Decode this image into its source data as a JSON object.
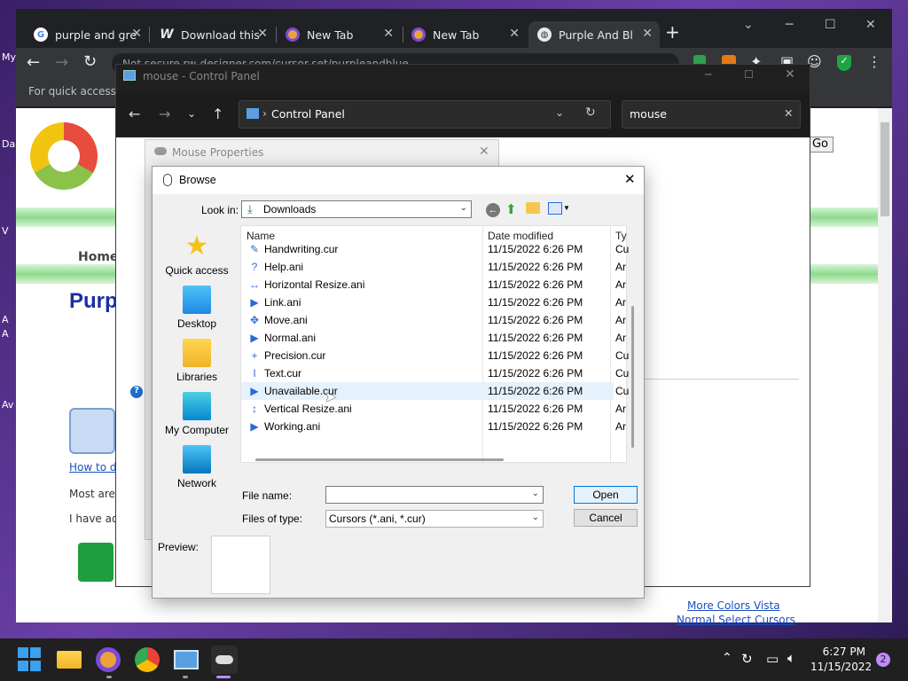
{
  "desktop": {
    "labels": [
      "My",
      "Da",
      "V",
      "A",
      "A",
      "Av"
    ]
  },
  "chrome": {
    "tabs": [
      {
        "label": "purple and gre"
      },
      {
        "label": "Download this"
      },
      {
        "label": "New Tab"
      },
      {
        "label": "New Tab"
      },
      {
        "label": "Purple And Bl"
      }
    ],
    "address": "Not secure   rw-designer.com/cursor-set/purpleandblue",
    "bookmarks_text": "For quick access, p"
  },
  "page": {
    "home": "Home",
    "title": "Purp",
    "go": "Go",
    "how_to": "How to do",
    "most_are": "Most are a",
    "i_have": "I have ad",
    "more_colors": "More Colors Vista",
    "normal_select": "Normal Select Cursors"
  },
  "control_panel": {
    "title": "mouse - Control Panel",
    "address": "Control Panel",
    "search": "mouse"
  },
  "mouse_properties": {
    "title": "Mouse Properties"
  },
  "browse": {
    "title": "Browse",
    "look_in_label": "Look in:",
    "look_in_value": "Downloads",
    "places": [
      {
        "label": "Quick access"
      },
      {
        "label": "Desktop"
      },
      {
        "label": "Libraries"
      },
      {
        "label": "My Computer"
      },
      {
        "label": "Network"
      }
    ],
    "columns": {
      "name": "Name",
      "date": "Date modified",
      "type": "Ty"
    },
    "files": [
      {
        "name": "Handwriting.cur",
        "date": "11/15/2022 6:26 PM",
        "type": "Cu",
        "icon": "✎"
      },
      {
        "name": "Help.ani",
        "date": "11/15/2022 6:26 PM",
        "type": "Ar",
        "icon": "?"
      },
      {
        "name": "Horizontal Resize.ani",
        "date": "11/15/2022 6:26 PM",
        "type": "Ar",
        "icon": "↔"
      },
      {
        "name": "Link.ani",
        "date": "11/15/2022 6:26 PM",
        "type": "Ar",
        "icon": "▶"
      },
      {
        "name": "Move.ani",
        "date": "11/15/2022 6:26 PM",
        "type": "Ar",
        "icon": "✥"
      },
      {
        "name": "Normal.ani",
        "date": "11/15/2022 6:26 PM",
        "type": "Ar",
        "icon": "▶"
      },
      {
        "name": "Precision.cur",
        "date": "11/15/2022 6:26 PM",
        "type": "Cu",
        "icon": "+"
      },
      {
        "name": "Text.cur",
        "date": "11/15/2022 6:26 PM",
        "type": "Cu",
        "icon": "I"
      },
      {
        "name": "Unavailable.cur",
        "date": "11/15/2022 6:26 PM",
        "type": "Cu",
        "icon": "▶"
      },
      {
        "name": "Vertical Resize.ani",
        "date": "11/15/2022 6:26 PM",
        "type": "Ar",
        "icon": "↕"
      },
      {
        "name": "Working.ani",
        "date": "11/15/2022 6:26 PM",
        "type": "Ar",
        "icon": "▶"
      }
    ],
    "file_name_label": "File name:",
    "file_name_value": "",
    "files_of_type_label": "Files of type:",
    "files_of_type_value": "Cursors (*.ani, *.cur)",
    "open": "Open",
    "cancel": "Cancel",
    "preview_label": "Preview:"
  },
  "taskbar": {
    "time": "6:27 PM",
    "date": "11/15/2022",
    "notifications": "2"
  }
}
